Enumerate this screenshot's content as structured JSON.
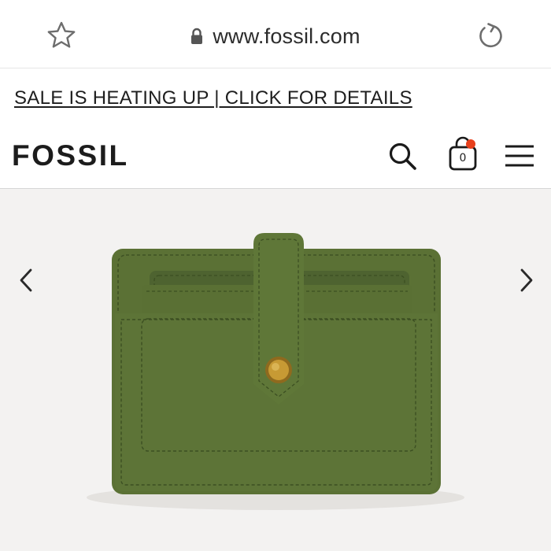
{
  "browser": {
    "url": "www.fossil.com",
    "icons": {
      "favorite": "star-icon",
      "secure": "lock-icon",
      "reload": "reload-icon"
    }
  },
  "promo": {
    "text": "SALE IS HEATING UP | CLICK FOR DETAILS"
  },
  "header": {
    "logo": "FOSSIL",
    "cart_count": "0",
    "icons": {
      "search": "search-icon",
      "cart": "shopping-bag-icon",
      "menu": "hamburger-menu-icon"
    },
    "colors": {
      "cart_badge": "#e8401c"
    }
  },
  "gallery": {
    "image": "green leather card case wallet",
    "colors": {
      "background": "#f3f2f1",
      "product": "#5b7135"
    },
    "icons": {
      "prev": "chevron-left-icon",
      "next": "chevron-right-icon"
    }
  }
}
